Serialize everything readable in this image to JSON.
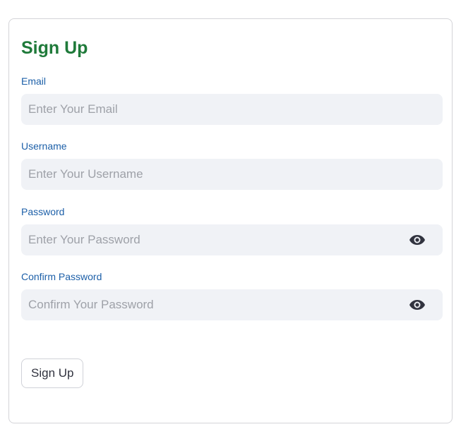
{
  "form": {
    "title": "Sign Up",
    "fields": [
      {
        "label": "Email",
        "placeholder": "Enter Your Email",
        "value": "",
        "type": "text",
        "has_toggle": false
      },
      {
        "label": "Username",
        "placeholder": "Enter Your Username",
        "value": "",
        "type": "text",
        "has_toggle": false
      },
      {
        "label": "Password",
        "placeholder": "Enter Your Password",
        "value": "",
        "type": "password",
        "has_toggle": true,
        "toggle_icon": "eye-icon"
      },
      {
        "label": "Confirm Password",
        "placeholder": "Confirm Your Password",
        "value": "",
        "type": "password",
        "has_toggle": true,
        "toggle_icon": "eye-icon"
      }
    ],
    "submit_label": "Sign Up"
  },
  "colors": {
    "title": "#1f7a3a",
    "label": "#1c5fa8",
    "input_bg": "#f0f2f6",
    "placeholder": "#9ea1a8",
    "border": "#d4d4d8",
    "icon": "#31333f"
  }
}
